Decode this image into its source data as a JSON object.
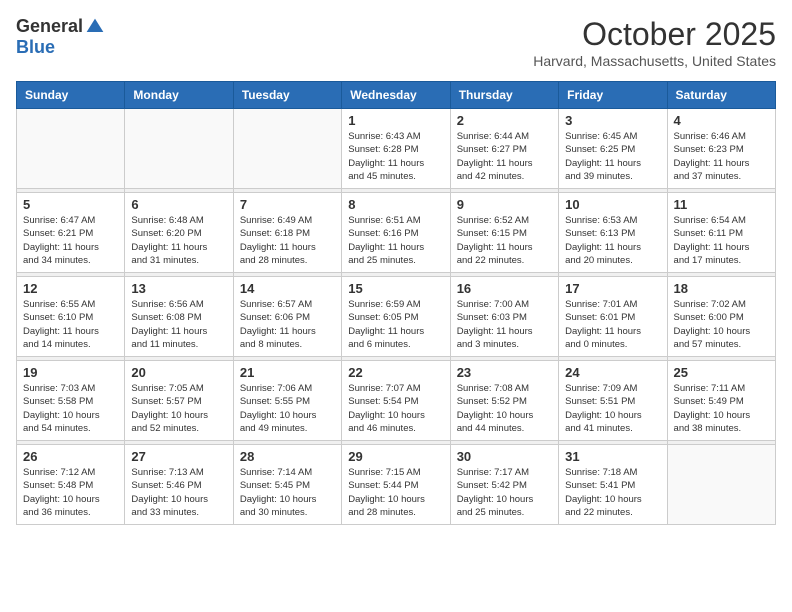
{
  "header": {
    "logo_general": "General",
    "logo_blue": "Blue",
    "month_title": "October 2025",
    "location": "Harvard, Massachusetts, United States"
  },
  "weekdays": [
    "Sunday",
    "Monday",
    "Tuesday",
    "Wednesday",
    "Thursday",
    "Friday",
    "Saturday"
  ],
  "weeks": [
    [
      {
        "day": "",
        "info": ""
      },
      {
        "day": "",
        "info": ""
      },
      {
        "day": "",
        "info": ""
      },
      {
        "day": "1",
        "info": "Sunrise: 6:43 AM\nSunset: 6:28 PM\nDaylight: 11 hours\nand 45 minutes."
      },
      {
        "day": "2",
        "info": "Sunrise: 6:44 AM\nSunset: 6:27 PM\nDaylight: 11 hours\nand 42 minutes."
      },
      {
        "day": "3",
        "info": "Sunrise: 6:45 AM\nSunset: 6:25 PM\nDaylight: 11 hours\nand 39 minutes."
      },
      {
        "day": "4",
        "info": "Sunrise: 6:46 AM\nSunset: 6:23 PM\nDaylight: 11 hours\nand 37 minutes."
      }
    ],
    [
      {
        "day": "5",
        "info": "Sunrise: 6:47 AM\nSunset: 6:21 PM\nDaylight: 11 hours\nand 34 minutes."
      },
      {
        "day": "6",
        "info": "Sunrise: 6:48 AM\nSunset: 6:20 PM\nDaylight: 11 hours\nand 31 minutes."
      },
      {
        "day": "7",
        "info": "Sunrise: 6:49 AM\nSunset: 6:18 PM\nDaylight: 11 hours\nand 28 minutes."
      },
      {
        "day": "8",
        "info": "Sunrise: 6:51 AM\nSunset: 6:16 PM\nDaylight: 11 hours\nand 25 minutes."
      },
      {
        "day": "9",
        "info": "Sunrise: 6:52 AM\nSunset: 6:15 PM\nDaylight: 11 hours\nand 22 minutes."
      },
      {
        "day": "10",
        "info": "Sunrise: 6:53 AM\nSunset: 6:13 PM\nDaylight: 11 hours\nand 20 minutes."
      },
      {
        "day": "11",
        "info": "Sunrise: 6:54 AM\nSunset: 6:11 PM\nDaylight: 11 hours\nand 17 minutes."
      }
    ],
    [
      {
        "day": "12",
        "info": "Sunrise: 6:55 AM\nSunset: 6:10 PM\nDaylight: 11 hours\nand 14 minutes."
      },
      {
        "day": "13",
        "info": "Sunrise: 6:56 AM\nSunset: 6:08 PM\nDaylight: 11 hours\nand 11 minutes."
      },
      {
        "day": "14",
        "info": "Sunrise: 6:57 AM\nSunset: 6:06 PM\nDaylight: 11 hours\nand 8 minutes."
      },
      {
        "day": "15",
        "info": "Sunrise: 6:59 AM\nSunset: 6:05 PM\nDaylight: 11 hours\nand 6 minutes."
      },
      {
        "day": "16",
        "info": "Sunrise: 7:00 AM\nSunset: 6:03 PM\nDaylight: 11 hours\nand 3 minutes."
      },
      {
        "day": "17",
        "info": "Sunrise: 7:01 AM\nSunset: 6:01 PM\nDaylight: 11 hours\nand 0 minutes."
      },
      {
        "day": "18",
        "info": "Sunrise: 7:02 AM\nSunset: 6:00 PM\nDaylight: 10 hours\nand 57 minutes."
      }
    ],
    [
      {
        "day": "19",
        "info": "Sunrise: 7:03 AM\nSunset: 5:58 PM\nDaylight: 10 hours\nand 54 minutes."
      },
      {
        "day": "20",
        "info": "Sunrise: 7:05 AM\nSunset: 5:57 PM\nDaylight: 10 hours\nand 52 minutes."
      },
      {
        "day": "21",
        "info": "Sunrise: 7:06 AM\nSunset: 5:55 PM\nDaylight: 10 hours\nand 49 minutes."
      },
      {
        "day": "22",
        "info": "Sunrise: 7:07 AM\nSunset: 5:54 PM\nDaylight: 10 hours\nand 46 minutes."
      },
      {
        "day": "23",
        "info": "Sunrise: 7:08 AM\nSunset: 5:52 PM\nDaylight: 10 hours\nand 44 minutes."
      },
      {
        "day": "24",
        "info": "Sunrise: 7:09 AM\nSunset: 5:51 PM\nDaylight: 10 hours\nand 41 minutes."
      },
      {
        "day": "25",
        "info": "Sunrise: 7:11 AM\nSunset: 5:49 PM\nDaylight: 10 hours\nand 38 minutes."
      }
    ],
    [
      {
        "day": "26",
        "info": "Sunrise: 7:12 AM\nSunset: 5:48 PM\nDaylight: 10 hours\nand 36 minutes."
      },
      {
        "day": "27",
        "info": "Sunrise: 7:13 AM\nSunset: 5:46 PM\nDaylight: 10 hours\nand 33 minutes."
      },
      {
        "day": "28",
        "info": "Sunrise: 7:14 AM\nSunset: 5:45 PM\nDaylight: 10 hours\nand 30 minutes."
      },
      {
        "day": "29",
        "info": "Sunrise: 7:15 AM\nSunset: 5:44 PM\nDaylight: 10 hours\nand 28 minutes."
      },
      {
        "day": "30",
        "info": "Sunrise: 7:17 AM\nSunset: 5:42 PM\nDaylight: 10 hours\nand 25 minutes."
      },
      {
        "day": "31",
        "info": "Sunrise: 7:18 AM\nSunset: 5:41 PM\nDaylight: 10 hours\nand 22 minutes."
      },
      {
        "day": "",
        "info": ""
      }
    ]
  ]
}
